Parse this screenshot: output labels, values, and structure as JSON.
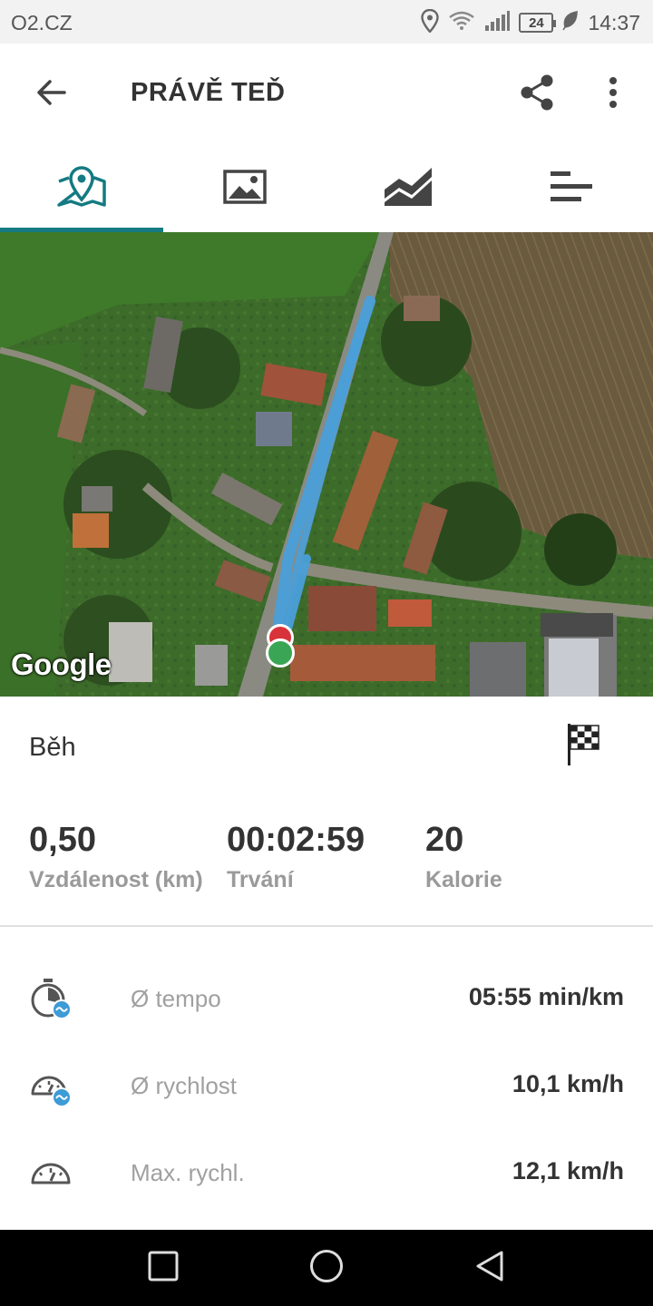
{
  "status_bar": {
    "carrier": "O2.CZ",
    "battery": "24",
    "time": "14:37"
  },
  "app_bar": {
    "title": "PRÁVĚ TEĎ",
    "icons": [
      "arrow-back-icon",
      "share-icon",
      "more-vert-icon"
    ]
  },
  "tabs": [
    {
      "icon": "map-pin-icon",
      "active": true
    },
    {
      "icon": "image-icon",
      "active": false
    },
    {
      "icon": "chart-area-icon",
      "active": false
    },
    {
      "icon": "list-bars-icon",
      "active": false
    }
  ],
  "map": {
    "attribution": "Google",
    "route_color": "#4a9fd8",
    "start_marker_color": "#3aa655",
    "end_marker_color": "#d8333a"
  },
  "activity": {
    "type": "Běh",
    "summary": [
      {
        "value": "0,50",
        "label": "Vzdálenost (km)"
      },
      {
        "value": "00:02:59",
        "label": "Trvání"
      },
      {
        "value": "20",
        "label": "Kalorie"
      }
    ],
    "metrics": [
      {
        "icon": "avg-pace-icon",
        "label": "Ø tempo",
        "value": "05:55 min/km"
      },
      {
        "icon": "avg-speed-icon",
        "label": "Ø rychlost",
        "value": "10,1 km/h"
      },
      {
        "icon": "max-speed-icon",
        "label": "Max. rychl.",
        "value": "12,1 km/h"
      }
    ]
  },
  "colors": {
    "accent": "#157a82",
    "text_primary": "#333333",
    "text_secondary": "#9a9a9a"
  }
}
